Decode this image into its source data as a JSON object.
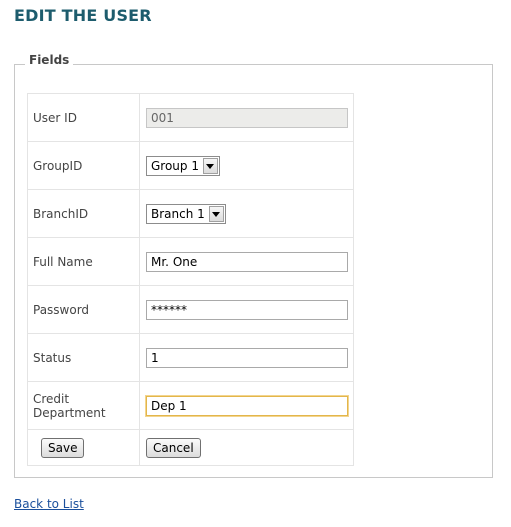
{
  "header": {
    "title": "EDIT THE USER"
  },
  "fieldset": {
    "legend": "Fields"
  },
  "form": {
    "user_id": {
      "label": "User ID",
      "value": "001"
    },
    "group_id": {
      "label": "GroupID",
      "selected": "Group 1"
    },
    "branch_id": {
      "label": "BranchID",
      "selected": "Branch 1"
    },
    "full_name": {
      "label": "Full Name",
      "value": "Mr. One"
    },
    "password": {
      "label": "Password",
      "value": "******"
    },
    "status": {
      "label": "Status",
      "value": "1"
    },
    "credit_department": {
      "label": "Credit Department",
      "value": "Dep 1"
    }
  },
  "actions": {
    "save_label": "Save",
    "cancel_label": "Cancel"
  },
  "footer": {
    "back_link": "Back to List"
  },
  "colors": {
    "title": "#1d5c6d",
    "link": "#1a4f9c",
    "focus_border": "#e3b64b"
  }
}
